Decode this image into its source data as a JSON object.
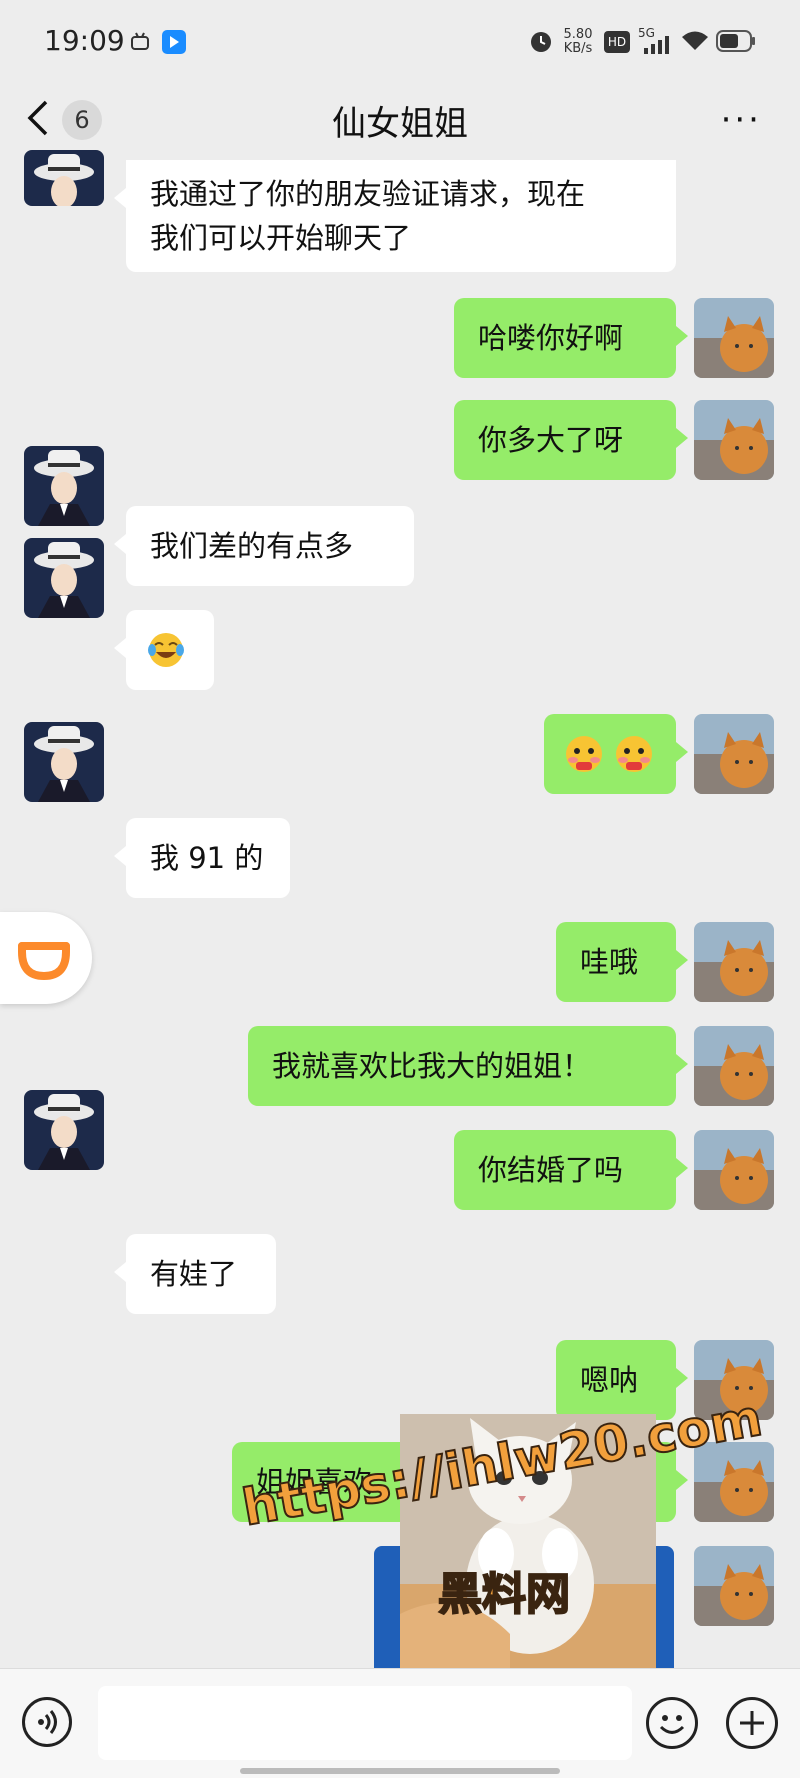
{
  "status_bar": {
    "time": "19:09",
    "net_speed_value": "5.80",
    "net_speed_unit": "KB/s",
    "hd_label": "HD",
    "signal_label": "5G"
  },
  "header": {
    "back_count": "6",
    "title": "仙女姐姐",
    "more": "···"
  },
  "messages": [
    {
      "side": "left",
      "text": "我通过了你的朋友验证请求，现在\n我们可以开始聊天了"
    },
    {
      "side": "right",
      "text": "哈喽你好啊"
    },
    {
      "side": "right",
      "text": "你多大了呀"
    },
    {
      "side": "left",
      "text": "我们差的有点多"
    },
    {
      "side": "left",
      "emoji": "crying-laughing-emoji"
    },
    {
      "side": "right",
      "emoji": "blush-emoji-pair"
    },
    {
      "side": "left",
      "text": "我 91 的"
    },
    {
      "side": "right",
      "text": "哇哦"
    },
    {
      "side": "right",
      "text": "我就喜欢比我大的姐姐！"
    },
    {
      "side": "right",
      "text": "你结婚了吗"
    },
    {
      "side": "left",
      "text": "有娃了"
    },
    {
      "side": "right",
      "text": "嗯呐"
    },
    {
      "side": "right",
      "text": "姐姐喜欢"
    }
  ],
  "watermark": {
    "url": "https://ihlw20.com",
    "name": "黑料网"
  },
  "colors": {
    "background": "#ededed",
    "right_bubble": "#95ec69",
    "left_bubble": "#ffffff",
    "didi_orange": "#fc8a2b",
    "watermark_fill": "#f2a03c"
  }
}
